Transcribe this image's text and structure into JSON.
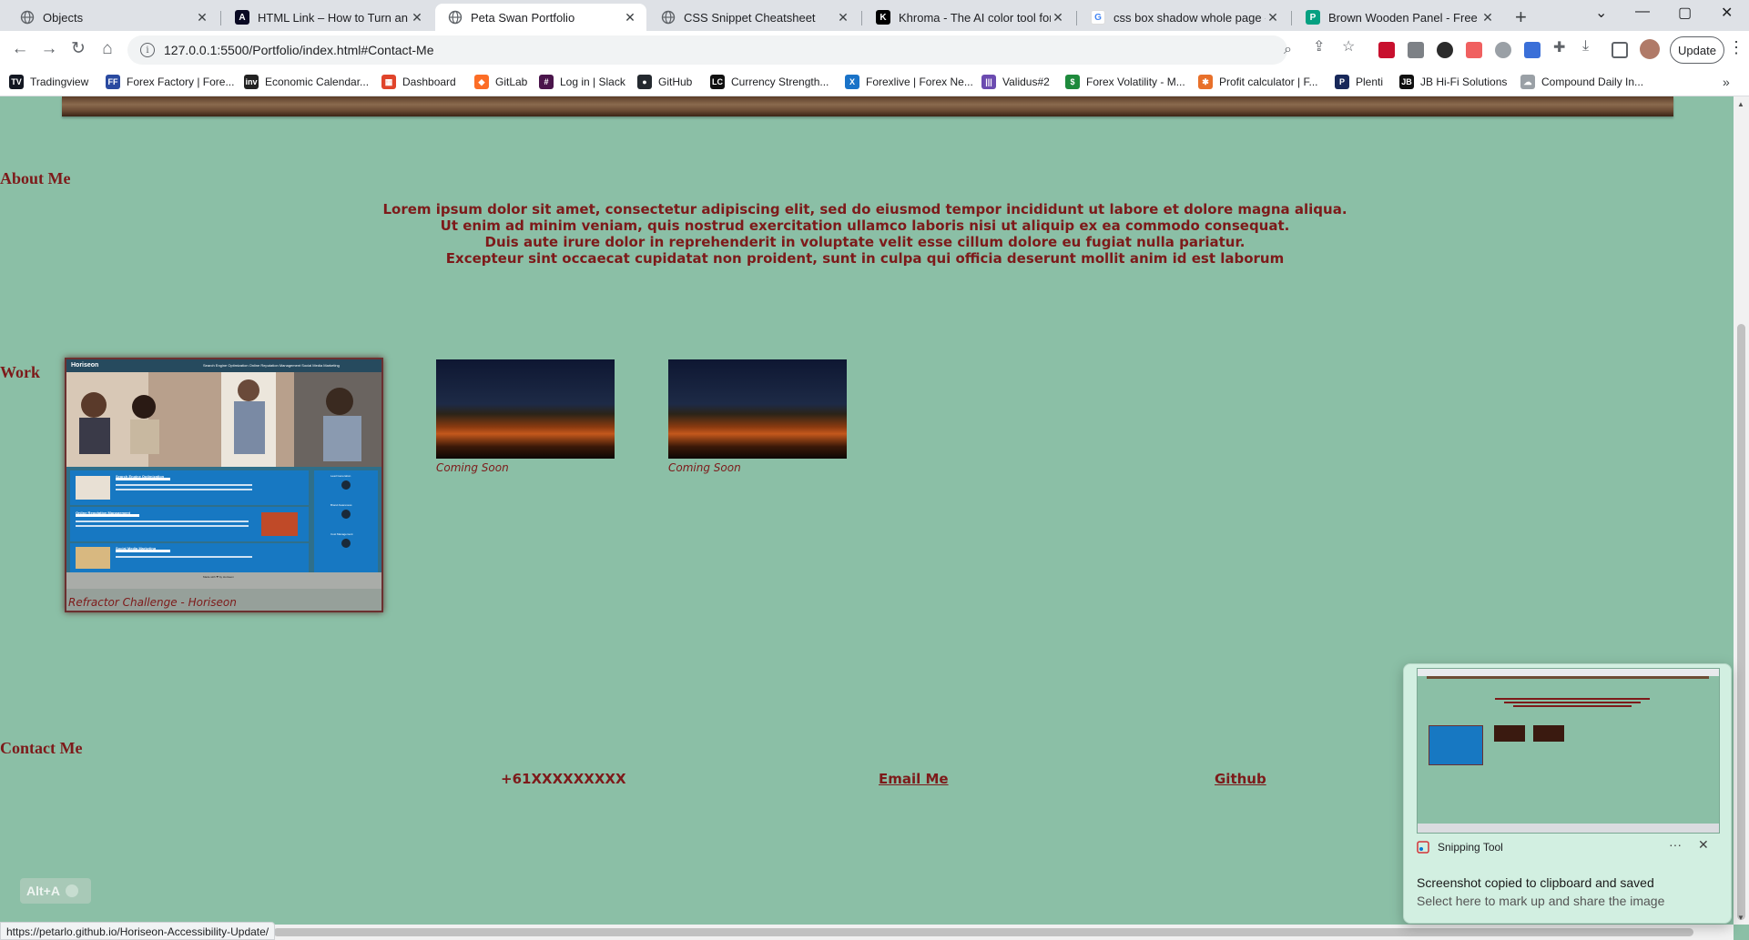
{
  "browser": {
    "tabs": [
      {
        "title": "Objects",
        "active": false,
        "icon": "globe-icon"
      },
      {
        "title": "HTML Link – How to Turn an Image into a Link",
        "active": false,
        "icon": "freecodecamp-icon"
      },
      {
        "title": "Peta Swan Portfolio",
        "active": true,
        "icon": "globe-icon"
      },
      {
        "title": "CSS Snippet Cheatsheet",
        "active": false,
        "icon": "globe-icon"
      },
      {
        "title": "Khroma - The AI color tool for designers",
        "active": false,
        "icon": "khroma-icon"
      },
      {
        "title": "css box shadow whole page - Google Search",
        "active": false,
        "icon": "google-icon"
      },
      {
        "title": "Brown Wooden Panel - Free Stock Photo",
        "active": false,
        "icon": "pexels-icon"
      }
    ],
    "new_tab": "+",
    "window_controls": {
      "search_tabs": "⌄",
      "minimize": "—",
      "maximize": "▢",
      "close": "✕"
    },
    "nav": {
      "back": "←",
      "forward": "→",
      "reload": "↻",
      "home": "⌂"
    },
    "url": "127.0.0.1:5500/Portfolio/index.html#Contact-Me",
    "update_label": "Update",
    "bookmarks": [
      {
        "label": "Tradingview",
        "icon_text": "TV",
        "color": "#131722"
      },
      {
        "label": "Forex Factory | Fore...",
        "icon_text": "FF",
        "color": "#2a4aa0"
      },
      {
        "label": "Economic Calendar...",
        "icon_text": "inv",
        "color": "#222222"
      },
      {
        "label": "Dashboard",
        "icon_text": "▦",
        "color": "#e0442a"
      },
      {
        "label": "GitLab",
        "icon_text": "◆",
        "color": "#fc6d26"
      },
      {
        "label": "Log in | Slack",
        "icon_text": "#",
        "color": "#4a154b"
      },
      {
        "label": "GitHub",
        "icon_text": "●",
        "color": "#24292f"
      },
      {
        "label": "Currency Strength...",
        "icon_text": "LC",
        "color": "#111111"
      },
      {
        "label": "Forexlive | Forex Ne...",
        "icon_text": "X",
        "color": "#1a73c8"
      },
      {
        "label": "Validus#2",
        "icon_text": "|||",
        "color": "#6b4bb0"
      },
      {
        "label": "Forex Volatility - M...",
        "icon_text": "$",
        "color": "#1e8a3c"
      },
      {
        "label": "Profit calculator | F...",
        "icon_text": "✱",
        "color": "#e8702a"
      },
      {
        "label": "Plenti",
        "icon_text": "P",
        "color": "#18285a"
      },
      {
        "label": "JB Hi-Fi Solutions",
        "icon_text": "JB",
        "color": "#111111"
      },
      {
        "label": "Compound Daily In...",
        "icon_text": "☁",
        "color": "#9aa0a6"
      }
    ],
    "bookmarks_more": "»",
    "status_url": "https://petarlo.github.io/Horiseon-Accessibility-Update/"
  },
  "page": {
    "about": {
      "heading": "About Me",
      "lines": [
        "Lorem ipsum dolor sit amet, consectetur adipiscing elit, sed do eiusmod tempor incididunt ut labore et dolore magna aliqua.",
        "Ut enim ad minim veniam, quis nostrud exercitation ullamco laboris nisi ut aliquip ex ea commodo consequat.",
        "Duis aute irure dolor in reprehenderit in voluptate velit esse cillum dolore eu fugiat nulla pariatur.",
        "Excepteur sint occaecat cupidatat non proident, sunt in culpa qui officia deserunt mollit anim id est laborum"
      ]
    },
    "work": {
      "heading": "Work",
      "featured": {
        "caption": "Refractor Challenge - Horiseon",
        "logo": "Horiseon",
        "nav": "Search Engine Optimization   Online Reputation Management   Social Media Marketing",
        "services": [
          "Search Engine Optimization",
          "Online Reputation Management",
          "Social Media Marketing"
        ],
        "benefits": [
          "Lead Generation",
          "Brand Awareness",
          "Cost Management"
        ],
        "footer": "Made with ❤ by Horiseon"
      },
      "coming_soon": [
        "Coming Soon",
        "Coming Soon"
      ]
    },
    "contact": {
      "heading": "Contact Me",
      "phone": "+61XXXXXXXXX",
      "email_label": "Email Me",
      "github_label": "Github"
    },
    "shortcut_badge": "Alt+A"
  },
  "snipping_tool": {
    "app_name": "Snipping Tool",
    "more": "···",
    "close": "✕",
    "title": "Screenshot copied to clipboard and saved",
    "subtitle": "Select here to mark up and share the image"
  }
}
